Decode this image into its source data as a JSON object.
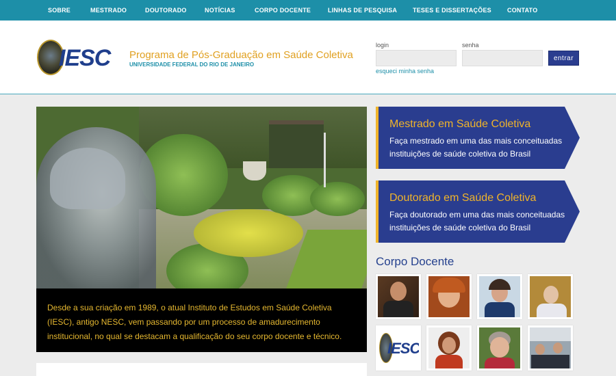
{
  "nav": {
    "items": [
      "SOBRE",
      "MESTRADO",
      "DOUTORADO",
      "NOTÍCIAS",
      "CORPO DOCENTE",
      "LINHAS DE PESQUISA",
      "TESES E DISSERTAÇÕES",
      "CONTATO"
    ]
  },
  "header": {
    "logo_text": "IESC",
    "program_title": "Programa de Pós-Graduação em Saúde Coletiva",
    "university": "UNIVERSIDADE FEDERAL DO RIO DE JANEIRO"
  },
  "login": {
    "login_label": "login",
    "login_value": "",
    "password_label": "senha",
    "password_value": "",
    "submit_label": "entrar",
    "forgot_link": "esqueci minha senha"
  },
  "hero": {
    "caption": "Desde a sua criação em 1989, o atual Instituto de Estudos em Saúde Coletiva (IESC), antigo NESC, vem passando por um processo de amadurecimento institucional, no qual se destacam a qualificação do seu corpo docente e técnico."
  },
  "promos": [
    {
      "title": "Mestrado em Saúde Coletiva",
      "description": "Faça mestrado em uma das mais conceituadas instituições de saúde coletiva do Brasil"
    },
    {
      "title": "Doutorado em Saúde Coletiva",
      "description": "Faça doutorado em uma das mais conceituadas instituições de saúde coletiva do Brasil"
    }
  ],
  "faculty": {
    "title": "Corpo Docente",
    "thumb_logo_text": "IESC"
  },
  "colors": {
    "nav_bg": "#1d8fa8",
    "promo_bg": "#2a3d8f",
    "accent_gold": "#f0b42a",
    "title_blue": "#25418e"
  }
}
